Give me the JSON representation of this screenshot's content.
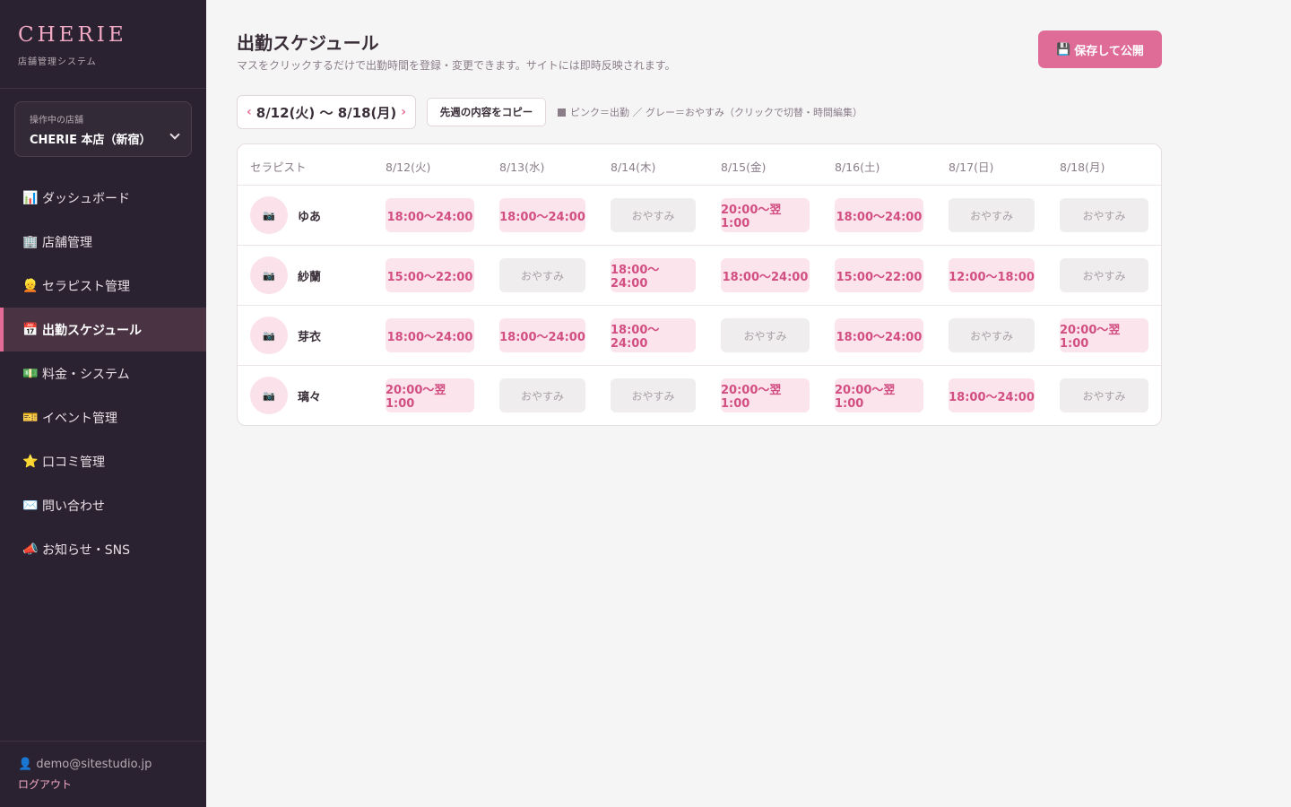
{
  "brand": {
    "name": "CHERIE",
    "subtitle": "店舗管理システム"
  },
  "store": {
    "label": "操作中の店舗",
    "value": "CHERIE 本店（新宿）"
  },
  "nav": [
    {
      "icon": "📊",
      "label": "ダッシュボード",
      "active": false
    },
    {
      "icon": "🏢",
      "label": "店舗管理",
      "active": false
    },
    {
      "icon": "👱",
      "label": "セラピスト管理",
      "active": false
    },
    {
      "icon": "📅",
      "label": "出勤スケジュール",
      "active": true
    },
    {
      "icon": "💵",
      "label": "料金・システム",
      "active": false
    },
    {
      "icon": "🎫",
      "label": "イベント管理",
      "active": false
    },
    {
      "icon": "⭐",
      "label": "口コミ管理",
      "active": false
    },
    {
      "icon": "✉️",
      "label": "問い合わせ",
      "active": false
    },
    {
      "icon": "📣",
      "label": "お知らせ・SNS",
      "active": false
    }
  ],
  "user": {
    "icon": "👤",
    "email": "demo@sitestudio.jp",
    "logout": "ログアウト"
  },
  "page": {
    "title": "出勤スケジュール",
    "description": "マスをクリックするだけで出勤時間を登録・変更できます。サイトには即時反映されます。",
    "save_icon": "💾",
    "save_label": "保存して公開"
  },
  "week": {
    "prev": "‹",
    "label": "8/12(火) 〜 8/18(月)",
    "next": "›"
  },
  "copy_label": "先週の内容をコピー",
  "legend": "ピンク＝出勤 ／ グレー＝おやすみ（クリックで切替・時間編集）",
  "table": {
    "first_header": "セラピスト",
    "days": [
      "8/12(火)",
      "8/13(水)",
      "8/14(木)",
      "8/15(金)",
      "8/16(土)",
      "8/17(日)",
      "8/18(月)"
    ],
    "avatar_icon": "📷",
    "off_label": "おやすみ",
    "rows": [
      {
        "name": "ゆあ",
        "shifts": [
          "18:00〜24:00",
          "18:00〜24:00",
          "",
          "20:00〜翌1:00",
          "18:00〜24:00",
          "",
          ""
        ]
      },
      {
        "name": "紗蘭",
        "shifts": [
          "15:00〜22:00",
          "",
          "18:00〜24:00",
          "18:00〜24:00",
          "15:00〜22:00",
          "12:00〜18:00",
          ""
        ]
      },
      {
        "name": "芽衣",
        "shifts": [
          "18:00〜24:00",
          "18:00〜24:00",
          "18:00〜24:00",
          "",
          "18:00〜24:00",
          "",
          "20:00〜翌1:00"
        ]
      },
      {
        "name": "璃々",
        "shifts": [
          "20:00〜翌1:00",
          "",
          "",
          "20:00〜翌1:00",
          "20:00〜翌1:00",
          "18:00〜24:00",
          ""
        ]
      }
    ]
  }
}
